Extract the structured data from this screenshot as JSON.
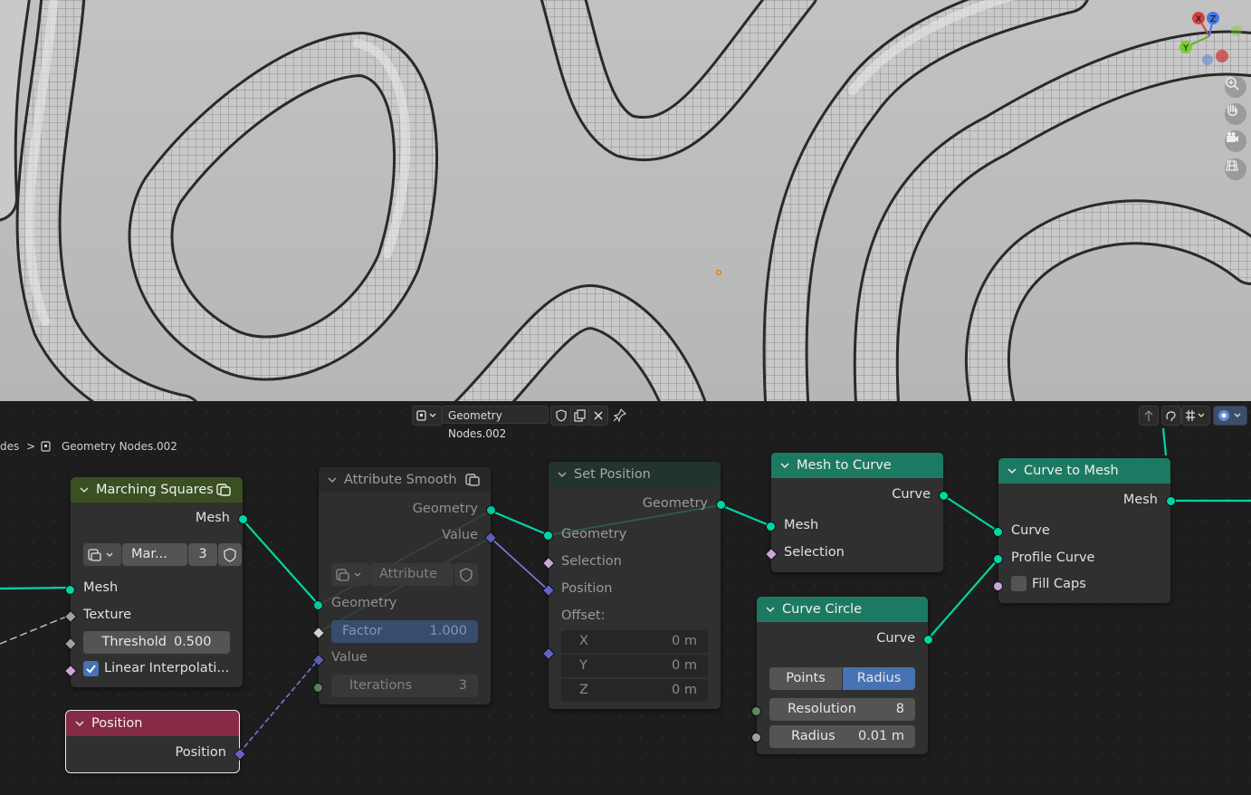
{
  "viewport": {
    "gizmo": {
      "x": "X",
      "y": "Y",
      "z": "Z"
    },
    "tools": [
      "zoom-icon",
      "hand-icon",
      "camera-icon",
      "grid-icon"
    ]
  },
  "header": {
    "node_tree_name": "Geometry Nodes.002"
  },
  "breadcrumb": {
    "parent": "des",
    "separator": ">",
    "current": "Geometry Nodes.002"
  },
  "nodes": {
    "marching_squares": {
      "title": "Marching Squares",
      "out_mesh": "Mesh",
      "group_name": "Mar...",
      "users": "3",
      "in_mesh": "Mesh",
      "texture": "Texture",
      "threshold_label": "Threshold",
      "threshold_value": "0.500",
      "linear_label": "Linear Interpolati...",
      "color": "#3a4f22"
    },
    "position": {
      "title": "Position",
      "out": "Position",
      "color": "#872a45"
    },
    "attribute_smooth": {
      "title": "Attribute Smooth",
      "out_geometry": "Geometry",
      "out_value": "Value",
      "group_name": "Attribute ...",
      "in_geometry": "Geometry",
      "factor_label": "Factor",
      "factor_value": "1.000",
      "value": "Value",
      "iterations_label": "Iterations",
      "iterations_value": "3"
    },
    "set_position": {
      "title": "Set Position",
      "out_geometry": "Geometry",
      "in_geometry": "Geometry",
      "selection": "Selection",
      "position": "Position",
      "offset": "Offset:",
      "x_label": "X",
      "x_value": "0 m",
      "y_label": "Y",
      "y_value": "0 m",
      "z_label": "Z",
      "z_value": "0 m"
    },
    "mesh_to_curve": {
      "title": "Mesh to Curve",
      "out_curve": "Curve",
      "in_mesh": "Mesh",
      "selection": "Selection",
      "color": "#1d7a62"
    },
    "curve_circle": {
      "title": "Curve Circle",
      "out_curve": "Curve",
      "mode_points": "Points",
      "mode_radius": "Radius",
      "resolution_label": "Resolution",
      "resolution_value": "8",
      "radius_label": "Radius",
      "radius_value": "0.01 m",
      "color": "#1d7a62"
    },
    "curve_to_mesh": {
      "title": "Curve to Mesh",
      "out_mesh": "Mesh",
      "in_curve": "Curve",
      "profile_curve": "Profile Curve",
      "fill_caps": "Fill Caps",
      "color": "#1d7a62"
    }
  }
}
